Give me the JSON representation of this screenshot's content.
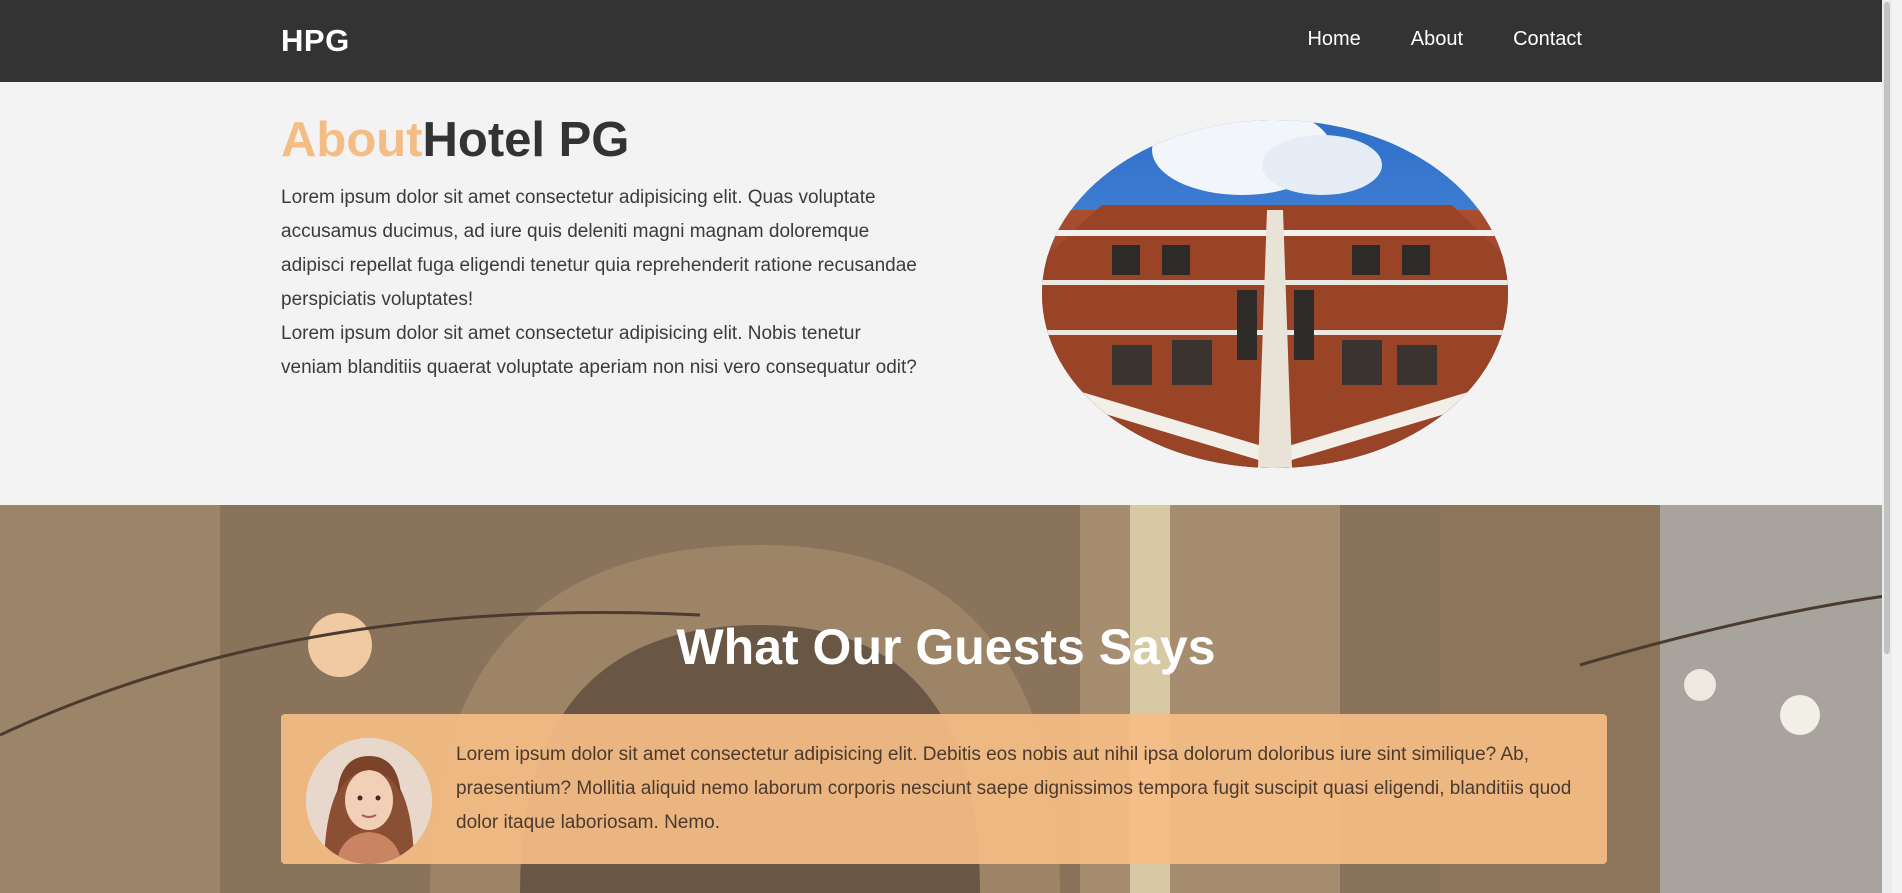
{
  "header": {
    "brand": "HPG",
    "nav": [
      {
        "label": "Home"
      },
      {
        "label": "About"
      },
      {
        "label": "Contact"
      }
    ]
  },
  "about": {
    "title_accent": "About",
    "title_rest": "Hotel PG",
    "paragraphs": [
      "Lorem ipsum dolor sit amet consectetur adipisicing elit. Quas voluptate accusamus ducimus, ad iure quis deleniti magni magnam doloremque adipisci repellat fuga eligendi tenetur quia reprehenderit ratione recusandae perspiciatis voluptates!",
      "Lorem ipsum dolor sit amet consectetur adipisicing elit. Nobis tenetur veniam blanditiis quaerat voluptate aperiam non nisi vero consequatur odit?"
    ]
  },
  "testimonials": {
    "title": "What Our Guests Says",
    "items": [
      {
        "quote": "Lorem ipsum dolor sit amet consectetur adipisicing elit. Debitis eos nobis aut nihil ipsa dolorum doloribus iure sint similique? Ab, praesentium? Mollitia aliquid nemo laborum corporis nesciunt saepe dignissimos tempora fugit suscipit quasi eligendi, blanditiis quod dolor itaque laboriosam. Nemo."
      }
    ]
  },
  "colors": {
    "nav_bg": "#333333",
    "accent": "#f5bd86",
    "page_bg": "#f3f3f3",
    "text_dark": "#333333"
  },
  "icons": {
    "hotel_image": "hotel-building-photo",
    "guest_avatar": "guest-avatar-photo"
  }
}
